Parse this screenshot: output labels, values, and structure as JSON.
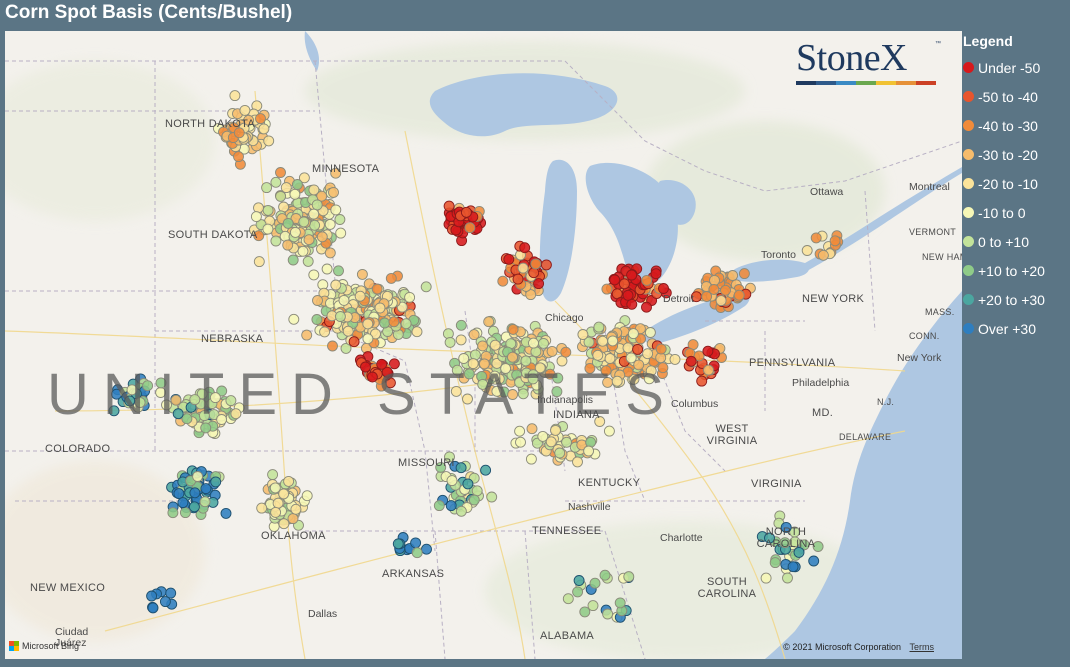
{
  "title": "Corn Spot Basis (Cents/Bushel)",
  "logo": {
    "text": "StoneX",
    "tm": "™",
    "bar_colors": [
      "#1f3a5f",
      "#2e5a8a",
      "#3a8ac4",
      "#6aa84f",
      "#f1c232",
      "#e69138",
      "#cc4125"
    ]
  },
  "legend": {
    "title": "Legend",
    "items": [
      {
        "label": "Under -50",
        "color": "#d7191c"
      },
      {
        "label": "-50 to -40",
        "color": "#e8552d"
      },
      {
        "label": "-40 to -30",
        "color": "#f08b3a"
      },
      {
        "label": "-30 to -20",
        "color": "#f6bc6c"
      },
      {
        "label": "-20 to -10",
        "color": "#fbe39a"
      },
      {
        "label": "-10 to 0",
        "color": "#f6f7b6"
      },
      {
        "label": "0 to +10",
        "color": "#c3e39a"
      },
      {
        "label": "+10 to +20",
        "color": "#8fcb88"
      },
      {
        "label": "+20 to +30",
        "color": "#4ba6a0"
      },
      {
        "label": "Over +30",
        "color": "#2f7ebf"
      }
    ]
  },
  "map": {
    "water_color": "#aec7e2",
    "land_color": "#f3f1ec",
    "country_label": "UNITED STATES",
    "states": [
      "NORTH DAKOTA",
      "MINNESOTA",
      "SOUTH DAKOTA",
      "NEBRASKA",
      "COLORADO",
      "MISSOURI",
      "INDIANA",
      "KENTUCKY",
      "TENNESSEE",
      "OKLAHOMA",
      "ARKANSAS",
      "NEW MEXICO",
      "ALABAMA",
      "WEST VIRGINIA",
      "VIRGINIA",
      "NORTH CAROLINA",
      "SOUTH CAROLINA",
      "PENNSYLVANIA",
      "NEW YORK",
      "VERMONT",
      "NEW HAMPSHIRE",
      "MASS.",
      "CONN.",
      "N.J.",
      "MD.",
      "DELAWARE"
    ],
    "cities": [
      "Ottawa",
      "Montreal",
      "Toronto",
      "Chicago",
      "Detroit",
      "Philadelphia",
      "New York",
      "Columbus",
      "Indianapolis",
      "Nashville",
      "Charlotte",
      "Dallas",
      "Ciudad Juárez"
    ],
    "attribution": {
      "provider": "Microsoft Bing",
      "copyright": "© 2021 Microsoft Corporation",
      "terms": "Terms"
    }
  }
}
